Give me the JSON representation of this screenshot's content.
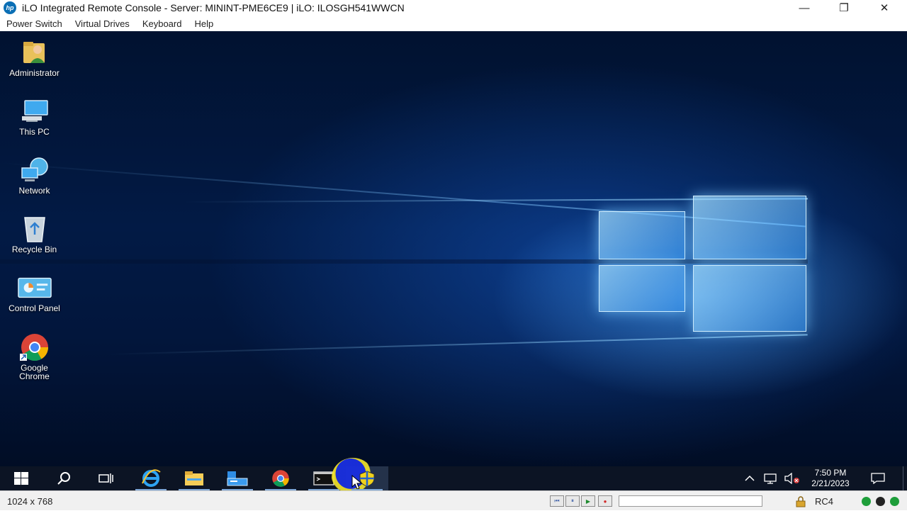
{
  "window": {
    "title": "iLO Integrated Remote Console - Server: MININT-PME6CE9 | iLO: ILOSGH541WWCN",
    "logo_text": "hp",
    "controls": {
      "minimize": "—",
      "restore": "❐",
      "close": "✕"
    }
  },
  "menu": [
    "Power Switch",
    "Virtual Drives",
    "Keyboard",
    "Help"
  ],
  "desktop": {
    "icons": [
      {
        "label": "Administrator",
        "icon": "user-folder-icon"
      },
      {
        "label": "This PC",
        "icon": "computer-icon"
      },
      {
        "label": "Network",
        "icon": "network-icon"
      },
      {
        "label": "Recycle Bin",
        "icon": "recycle-bin-icon"
      },
      {
        "label": "Control Panel",
        "icon": "control-panel-icon"
      },
      {
        "label": "Google Chrome",
        "icon": "chrome-icon"
      }
    ]
  },
  "taskbar": {
    "items": [
      {
        "icon": "windows-start-icon"
      },
      {
        "icon": "search-icon"
      },
      {
        "icon": "task-view-icon"
      },
      {
        "icon": "internet-explorer-icon"
      },
      {
        "icon": "file-explorer-icon"
      },
      {
        "icon": "server-manager-icon"
      },
      {
        "icon": "chrome-icon"
      },
      {
        "icon": "command-prompt-icon"
      },
      {
        "icon": "admin-tool-icon"
      }
    ],
    "tray": {
      "time": "7:50 PM",
      "date": "2/21/2023"
    }
  },
  "statusbar": {
    "resolution": "1024 x 768",
    "encryption": "RC4",
    "playback_progress": 0
  },
  "colors": {
    "desktop_dark": "#011230",
    "desktop_glow": "#50aaff",
    "taskbar": "#0c1424",
    "accent": "#0b6fb5",
    "led_green": "#1e9e3a"
  }
}
